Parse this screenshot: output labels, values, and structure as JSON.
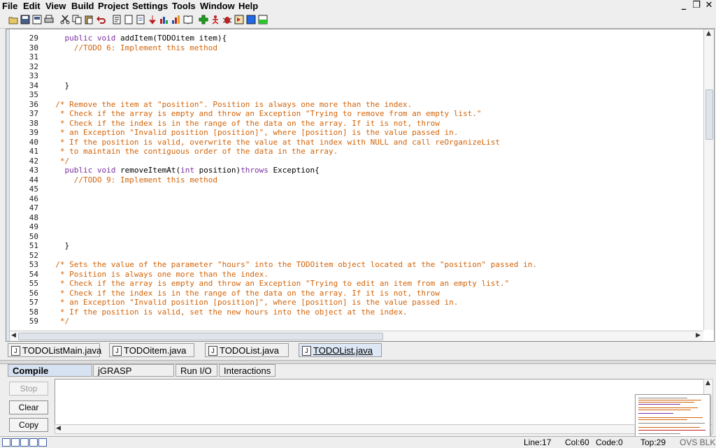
{
  "menu": {
    "items": [
      {
        "id": "file",
        "label": "File"
      },
      {
        "id": "edit",
        "label": "Edit"
      },
      {
        "id": "view",
        "label": "View"
      },
      {
        "id": "build",
        "label": "Build"
      },
      {
        "id": "project",
        "label": "Project"
      },
      {
        "id": "settings",
        "label": "Settings"
      },
      {
        "id": "tools",
        "label": "Tools"
      },
      {
        "id": "window",
        "label": "Window"
      },
      {
        "id": "help",
        "label": "Help"
      }
    ],
    "window_controls": {
      "minimize": "_",
      "restore": "❐",
      "close": "✕"
    }
  },
  "toolbar": {
    "buttons": [
      {
        "name": "open-icon"
      },
      {
        "name": "save-icon"
      },
      {
        "name": "save-all-icon"
      },
      {
        "name": "print-icon"
      },
      {
        "name": "cut-icon"
      },
      {
        "name": "copy-icon"
      },
      {
        "name": "paste-icon"
      },
      {
        "name": "undo-icon"
      },
      {
        "name": "generate-csd-icon"
      },
      {
        "name": "remove-csd-icon"
      },
      {
        "name": "generate-doc-icon"
      },
      {
        "name": "compile-icon"
      },
      {
        "name": "run-icon"
      },
      {
        "name": "debug-icon"
      },
      {
        "name": "jar-icon"
      },
      {
        "name": "book-icon"
      },
      {
        "name": "add-icon"
      },
      {
        "name": "run-applet-icon"
      },
      {
        "name": "bug-icon"
      },
      {
        "name": "step-icon"
      },
      {
        "name": "viewer-icon"
      },
      {
        "name": "color-blue-icon"
      },
      {
        "name": "color-green-icon"
      }
    ]
  },
  "editor": {
    "lines": [
      {
        "n": "29",
        "segs": [
          {
            "t": "    ",
            "c": "plain"
          },
          {
            "t": "public void",
            "c": "kw"
          },
          {
            "t": " addItem(TODOitem item){",
            "c": "plain"
          }
        ]
      },
      {
        "n": "30",
        "segs": [
          {
            "t": "      //TODO 6: Implement this method",
            "c": "cm"
          }
        ]
      },
      {
        "n": "31",
        "segs": []
      },
      {
        "n": "32",
        "segs": []
      },
      {
        "n": "33",
        "segs": []
      },
      {
        "n": "34",
        "segs": [
          {
            "t": "    }",
            "c": "plain"
          }
        ]
      },
      {
        "n": "35",
        "segs": []
      },
      {
        "n": "36",
        "segs": [
          {
            "t": "  /* Remove the item at \"position\". Position is always one more than the index.",
            "c": "cm"
          }
        ]
      },
      {
        "n": "37",
        "segs": [
          {
            "t": "   * Check if the array is empty and throw an Exception \"Trying to remove from an empty list.\"",
            "c": "cm"
          }
        ]
      },
      {
        "n": "38",
        "segs": [
          {
            "t": "   * Check if the index is in the range of the data on the array. If it is not, throw",
            "c": "cm"
          }
        ]
      },
      {
        "n": "39",
        "segs": [
          {
            "t": "   * an Exception \"Invalid position [position]\", where [position] is the value passed in.",
            "c": "cm"
          }
        ]
      },
      {
        "n": "40",
        "segs": [
          {
            "t": "   * If the position is valid, overwrite the value at that index with NULL and call reOrganizeList",
            "c": "cm"
          }
        ]
      },
      {
        "n": "41",
        "segs": [
          {
            "t": "   * to maintain the contiguous order of the data in the array.",
            "c": "cm"
          }
        ]
      },
      {
        "n": "42",
        "segs": [
          {
            "t": "   */",
            "c": "cm"
          }
        ]
      },
      {
        "n": "43",
        "segs": [
          {
            "t": "    ",
            "c": "plain"
          },
          {
            "t": "public void",
            "c": "kw"
          },
          {
            "t": " removeItemAt(",
            "c": "plain"
          },
          {
            "t": "int",
            "c": "kw"
          },
          {
            "t": " position)",
            "c": "plain"
          },
          {
            "t": "throws",
            "c": "kw"
          },
          {
            "t": " Exception{",
            "c": "plain"
          }
        ]
      },
      {
        "n": "44",
        "segs": [
          {
            "t": "      //TODO 9: Implement this method",
            "c": "cm"
          }
        ]
      },
      {
        "n": "45",
        "segs": []
      },
      {
        "n": "46",
        "segs": []
      },
      {
        "n": "47",
        "segs": []
      },
      {
        "n": "48",
        "segs": []
      },
      {
        "n": "49",
        "segs": []
      },
      {
        "n": "50",
        "segs": []
      },
      {
        "n": "51",
        "segs": [
          {
            "t": "    }",
            "c": "plain"
          }
        ]
      },
      {
        "n": "52",
        "segs": []
      },
      {
        "n": "53",
        "segs": [
          {
            "t": "  /* Sets the value of the parameter \"hours\" into the TODOitem object located at the \"position\" passed in.",
            "c": "cm"
          }
        ]
      },
      {
        "n": "54",
        "segs": [
          {
            "t": "   * Position is always one more than the index.",
            "c": "cm"
          }
        ]
      },
      {
        "n": "55",
        "segs": [
          {
            "t": "   * Check if the array is empty and throw an Exception \"Trying to edit an item from an empty list.\"",
            "c": "cm"
          }
        ]
      },
      {
        "n": "56",
        "segs": [
          {
            "t": "   * Check if the index is in the range of the data on the array. If it is not, throw",
            "c": "cm"
          }
        ]
      },
      {
        "n": "57",
        "segs": [
          {
            "t": "   * an Exception \"Invalid position [position]\", where [position] is the value passed in.",
            "c": "cm"
          }
        ]
      },
      {
        "n": "58",
        "segs": [
          {
            "t": "   * If the position is valid, set the new hours into the object at the index.",
            "c": "cm"
          }
        ]
      },
      {
        "n": "59",
        "segs": [
          {
            "t": "   */",
            "c": "cm"
          }
        ]
      }
    ]
  },
  "file_tabs": [
    {
      "label": "TODOListMain.java",
      "active": false
    },
    {
      "label": "TODOitem.java",
      "active": false
    },
    {
      "label": "TODOList.java",
      "active": false
    },
    {
      "label": "TODOList.java",
      "active": true
    }
  ],
  "file_tab_icon": "J",
  "message_tabs": [
    {
      "label": "Compile Messages",
      "active": true
    },
    {
      "label": "jGRASP Messages",
      "active": false
    },
    {
      "label": "Run I/O",
      "active": false
    },
    {
      "label": "Interactions",
      "active": false
    }
  ],
  "message_buttons": {
    "stop": "Stop",
    "clear": "Clear",
    "copy": "Copy"
  },
  "status": {
    "line": "Line:17",
    "col": "Col:60",
    "code": "Code:0",
    "top": "Top:29",
    "mode": "OVS BLK"
  },
  "colors": {
    "keyword": "#7b2fa0",
    "comment": "#d2640a",
    "accent": "#3a5da0"
  }
}
